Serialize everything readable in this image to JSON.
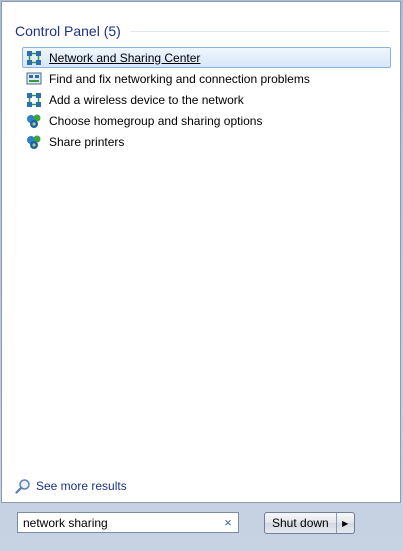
{
  "group": {
    "title": "Control Panel (5)"
  },
  "results": [
    {
      "label": "Network and Sharing Center",
      "icon": "network-sharing-icon",
      "selected": true
    },
    {
      "label": "Find and fix networking and connection problems",
      "icon": "troubleshoot-network-icon"
    },
    {
      "label": "Add a wireless device to the network",
      "icon": "network-device-icon"
    },
    {
      "label": "Choose homegroup and sharing options",
      "icon": "homegroup-icon"
    },
    {
      "label": "Share printers",
      "icon": "homegroup-icon"
    }
  ],
  "see_more": {
    "label": "See more results",
    "icon": "search-icon"
  },
  "search": {
    "value": "network sharing",
    "clear_glyph": "×"
  },
  "shutdown": {
    "label": "Shut down",
    "arrow": "▶"
  },
  "colors": {
    "accent": "#1e3287",
    "selection_border": "#8cb3e0"
  }
}
